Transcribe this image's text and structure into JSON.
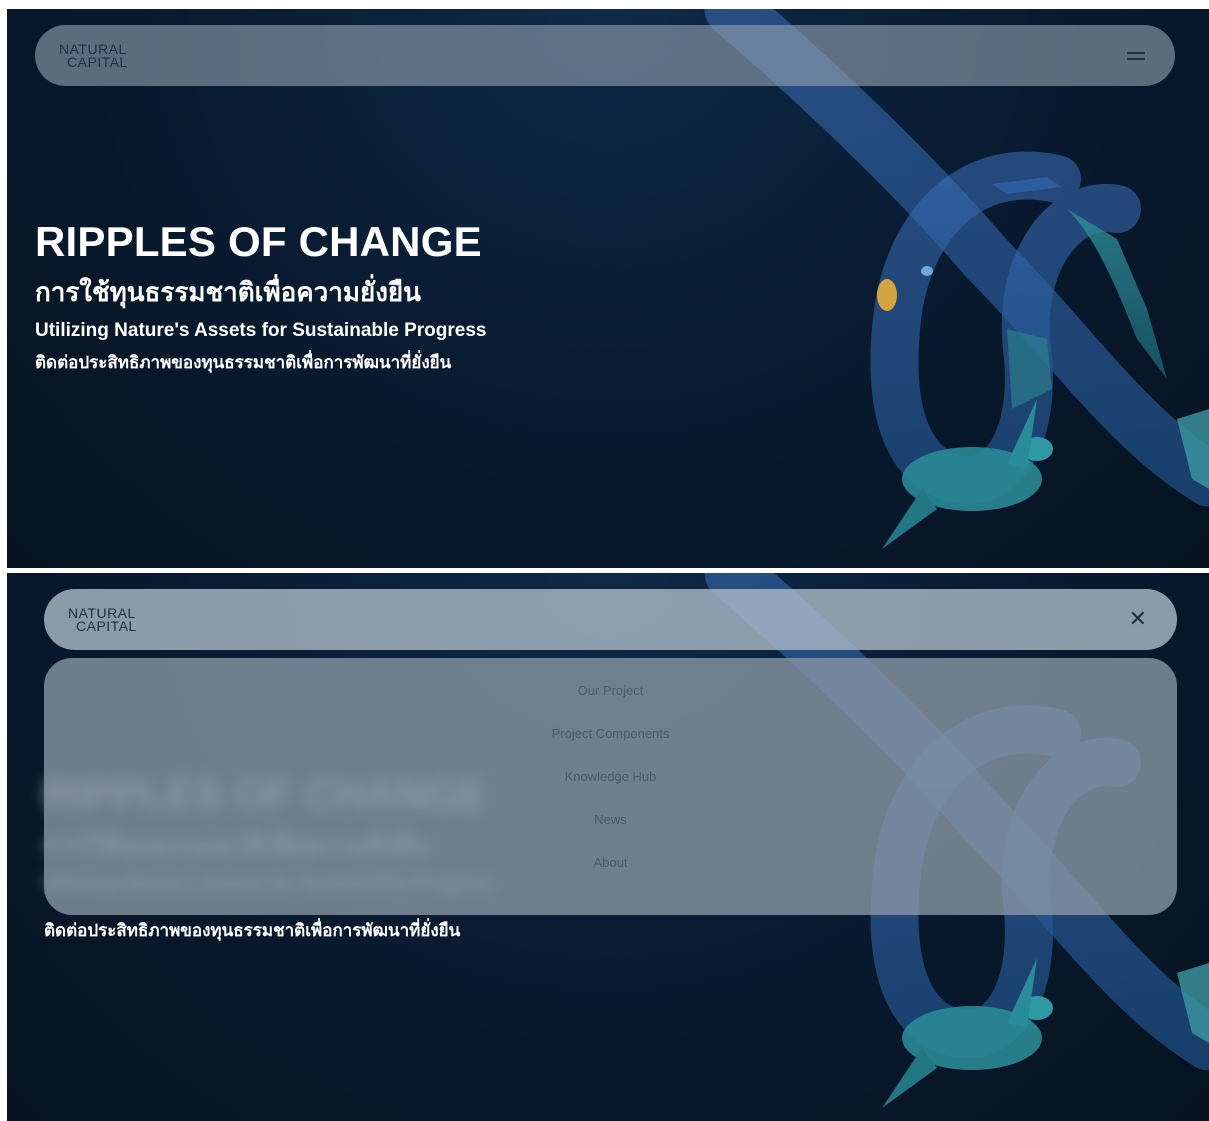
{
  "brand": {
    "logo_line1": "NATURAL",
    "logo_line2": "CAPITAL"
  },
  "hero": {
    "title": "RIPPLES OF CHANGE",
    "title_th": "การใช้ทุนธรรมชาติเพื่อความยั่งยืน",
    "subtitle_en": "Utilizing Nature's Assets for Sustainable Progress",
    "subtitle_th": "ติดต่อประสิทธิภาพของทุนธรรมชาติเพื่อการพัฒนาที่ยั่งยืน"
  },
  "menu": {
    "items": [
      {
        "label": "Our Project"
      },
      {
        "label": "Project Components"
      },
      {
        "label": "Knowledge Hub"
      },
      {
        "label": "News"
      },
      {
        "label": "About"
      }
    ]
  },
  "icons": {
    "open": "hamburger-menu-icon",
    "close": "close-icon"
  },
  "colors": {
    "background": "#0a1c33",
    "navbar": "#92a0af",
    "text": "#ffffff",
    "menu_text": "#4b5a6b"
  }
}
